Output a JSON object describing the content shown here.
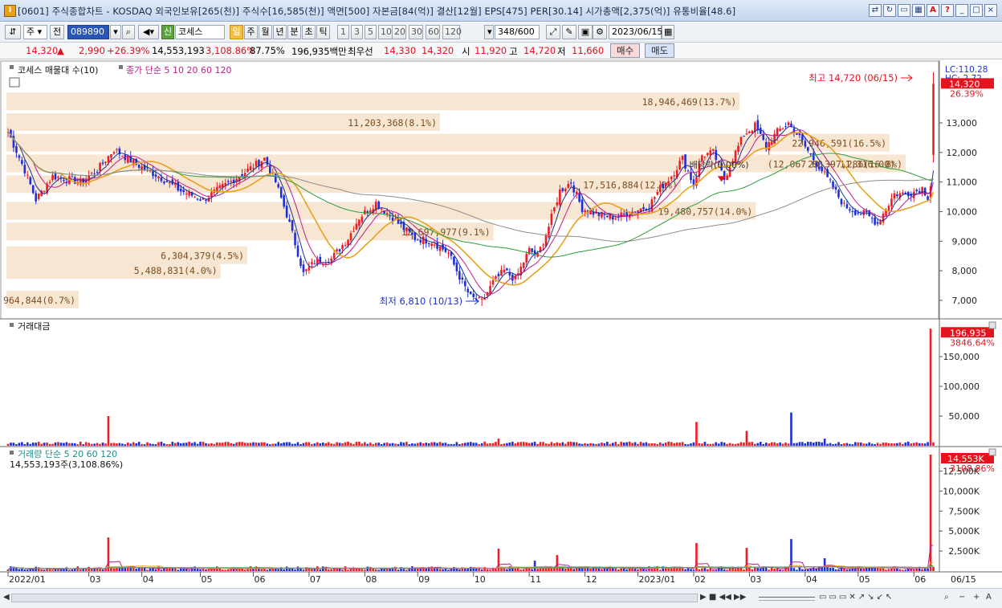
{
  "window": {
    "title": "[0601] 주식종합차트 - KOSDAQ 외국인보유[265(천)] 주식수[16,585(천)] 액면[500] 자본금[84(억)] 결산[12월] EPS[475] PER[30.14] 시가총액[2,375(억)] 유통비율[48.6]",
    "app_icon": "I"
  },
  "toolbar": {
    "type_select": "주",
    "prev_label": "전",
    "stock_code": "089890",
    "stock_name": "코세스",
    "credit_badge": "신",
    "periods": [
      "일",
      "주",
      "월",
      "년",
      "분",
      "초",
      "틱"
    ],
    "intervals": [
      "1",
      "3",
      "5",
      "10",
      "20",
      "30",
      "60",
      "120"
    ],
    "count": "348",
    "count_total": "/600",
    "date": "2023/06/15"
  },
  "quote": {
    "price": "14,320",
    "change": "2,990",
    "change_pct": "+26.39%",
    "volume": "14,553,193",
    "volume_pct": "3,108.86%",
    "ratio": "87.75%",
    "amount": "196,935백만",
    "bid_label": "최우선",
    "bid1": "14,330",
    "bid2": "14,320",
    "open_label": "시",
    "open": "11,920",
    "high_label": "고",
    "high": "14,720",
    "low_label": "저",
    "low": "11,660",
    "buy_label": "매수",
    "sell_label": "매도"
  },
  "panels": {
    "price_legend": "코세스 매물대 수(10)",
    "ma_legend": "종가 단순 5 10 20 60 120",
    "amount_legend": "거래대금",
    "volume_legend": "거래량 단순 5 20 60 120",
    "volume_note": "14,553,193주(3,108.86%)",
    "lc": "LC:110.28",
    "hc": "HC:-2.72",
    "max_label": "최고 14,720 (06/15)",
    "min_label": "최저 6,810 (10/13)",
    "dividend_label": "배당락(0.00%)",
    "price_tag": "14,320",
    "price_tag_pct": "26.39%",
    "amount_tag": "196,935",
    "amount_tag_pct": "3846.64%",
    "volume_tag": "14,553K",
    "volume_tag_pct": "3108.86%"
  },
  "colors": {
    "up": "#ee1c25",
    "down": "#1e2fd8",
    "ma5": "#1b2d9c",
    "ma10": "#c01b8c",
    "ma20": "#e7a21a",
    "ma60": "#2c9d3d",
    "ma120": "#8c8c8c",
    "profile": "#f7e6d2",
    "profile_text": "#7a4e21"
  },
  "chart_data": {
    "type": "candlestick",
    "x_tick_labels": [
      "2022/01",
      "03",
      "04",
      "05",
      "06",
      "07",
      "08",
      "09",
      "10",
      "11",
      "12",
      "2023/01",
      "02",
      "03",
      "04",
      "05",
      "06"
    ],
    "x_end_label": "06/15",
    "price_axis": {
      "ticks": [
        7000,
        8000,
        9000,
        10000,
        11000,
        12000,
        13000
      ],
      "labels": [
        "7,000",
        "8,000",
        "9,000",
        "10,000",
        "11,000",
        "12,000",
        "13,000"
      ],
      "range": [
        6400,
        14900
      ]
    },
    "amount_axis": {
      "ticks": [
        50000,
        100000,
        150000
      ],
      "labels": [
        "50,000",
        "100,000",
        "150,000"
      ],
      "max": 200000
    },
    "volume_axis": {
      "ticks": [
        2500,
        5000,
        7500,
        10000,
        12500
      ],
      "labels": [
        "2,500K",
        "5,000K",
        "7,500K",
        "10,000K",
        "12,500K"
      ],
      "max": 14553
    },
    "volume_profile": [
      {
        "price": 7000,
        "value": "964,844(0.7%)",
        "pct": 0.7
      },
      {
        "price": 8000,
        "value": "5,488,831(4.0%)",
        "pct": 4.0
      },
      {
        "price": 8500,
        "value": "6,304,379(4.5%)",
        "pct": 4.5
      },
      {
        "price": 9300,
        "value": "12,697,977(9.1%)",
        "pct": 9.1
      },
      {
        "price": 10000,
        "value": "19,480,757(14.0%)",
        "pct": 14.0
      },
      {
        "price": 10900,
        "value": "17,516,884(12.6%)",
        "pct": 12.6
      },
      {
        "price": 11600,
        "value": "23,397,286(16.8%)",
        "pct": 16.8
      },
      {
        "price": 12300,
        "value": "22,946,591(16.5%)",
        "pct": 16.5
      },
      {
        "price": 13000,
        "value": "11,203,368(8.1%)",
        "pct": 8.1
      },
      {
        "price": 13700,
        "value": "18,946,469(13.7%)",
        "pct": 13.7
      }
    ],
    "range_label": "(12,067.00 ~ 11,316.00)",
    "close_keypoints": [
      [
        0,
        12700
      ],
      [
        6,
        11400
      ],
      [
        10,
        10400
      ],
      [
        16,
        11200
      ],
      [
        26,
        11000
      ],
      [
        32,
        11400
      ],
      [
        38,
        12100
      ],
      [
        46,
        11600
      ],
      [
        54,
        11200
      ],
      [
        62,
        10700
      ],
      [
        70,
        10400
      ],
      [
        78,
        10900
      ],
      [
        86,
        11400
      ],
      [
        92,
        11800
      ],
      [
        96,
        11000
      ],
      [
        100,
        9900
      ],
      [
        104,
        8600
      ],
      [
        106,
        7900
      ],
      [
        110,
        8300
      ],
      [
        116,
        8400
      ],
      [
        122,
        9100
      ],
      [
        126,
        9800
      ],
      [
        132,
        10300
      ],
      [
        140,
        9600
      ],
      [
        146,
        9100
      ],
      [
        152,
        9000
      ],
      [
        158,
        8600
      ],
      [
        163,
        7600
      ],
      [
        166,
        7100
      ],
      [
        170,
        6950
      ],
      [
        174,
        7600
      ],
      [
        178,
        8000
      ],
      [
        182,
        7700
      ],
      [
        187,
        8700
      ],
      [
        190,
        8500
      ],
      [
        194,
        9500
      ],
      [
        198,
        10700
      ],
      [
        202,
        11000
      ],
      [
        206,
        10100
      ],
      [
        212,
        9900
      ],
      [
        218,
        9800
      ],
      [
        224,
        10000
      ],
      [
        230,
        10200
      ],
      [
        234,
        10800
      ],
      [
        238,
        11200
      ],
      [
        242,
        11800
      ],
      [
        246,
        10900
      ],
      [
        249,
        11900
      ],
      [
        253,
        12000
      ],
      [
        257,
        11100
      ],
      [
        260,
        11800
      ],
      [
        264,
        12600
      ],
      [
        268,
        12900
      ],
      [
        272,
        12200
      ],
      [
        276,
        12700
      ],
      [
        280,
        13000
      ],
      [
        284,
        12500
      ],
      [
        288,
        11900
      ],
      [
        292,
        11400
      ],
      [
        296,
        10800
      ],
      [
        300,
        10200
      ],
      [
        304,
        10000
      ],
      [
        308,
        9900
      ],
      [
        312,
        9600
      ],
      [
        315,
        10100
      ],
      [
        318,
        10600
      ],
      [
        322,
        10600
      ],
      [
        326,
        10700
      ],
      [
        328,
        10800
      ],
      [
        330,
        10500
      ],
      [
        331,
        10900
      ],
      [
        332,
        14320
      ]
    ],
    "amount_spikes": [
      [
        36,
        50000
      ],
      [
        176,
        12000
      ],
      [
        247,
        40000
      ],
      [
        265,
        25000
      ],
      [
        281,
        56000
      ],
      [
        293,
        12000
      ],
      [
        331,
        196935
      ]
    ],
    "volume_spikes": [
      [
        36,
        4200
      ],
      [
        176,
        2800
      ],
      [
        189,
        1300
      ],
      [
        197,
        2000
      ],
      [
        247,
        3500
      ],
      [
        265,
        2900
      ],
      [
        281,
        4000
      ],
      [
        293,
        1600
      ],
      [
        331,
        14553
      ]
    ]
  }
}
